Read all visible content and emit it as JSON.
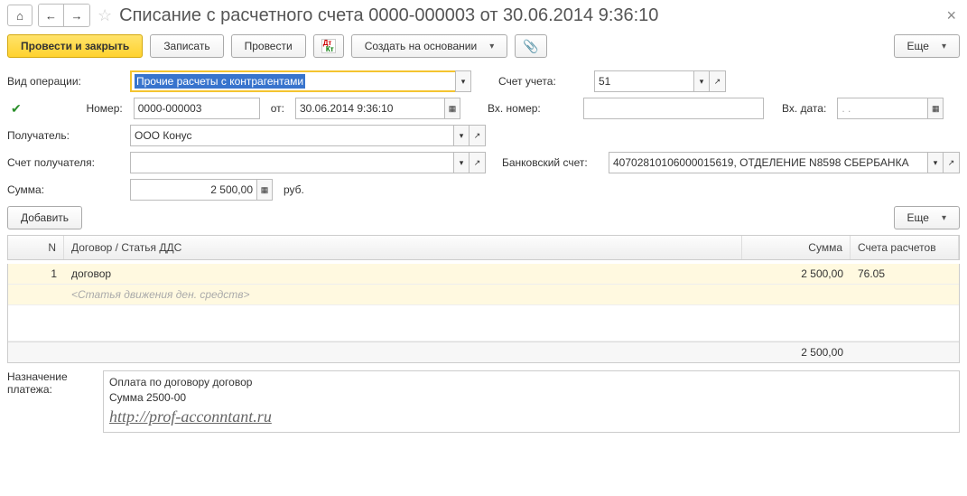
{
  "header": {
    "title": "Списание с расчетного счета 0000-000003 от 30.06.2014 9:36:10"
  },
  "toolbar": {
    "post_and_close": "Провести и закрыть",
    "save": "Записать",
    "post": "Провести",
    "create_based_on": "Создать на основании",
    "more": "Еще"
  },
  "form": {
    "operation_type_label": "Вид операции:",
    "operation_type_value": "Прочие расчеты с контрагентами",
    "account_label": "Счет учета:",
    "account_value": "51",
    "number_label": "Номер:",
    "number_value": "0000-000003",
    "from_label": "от:",
    "date_value": "30.06.2014  9:36:10",
    "ext_number_label": "Вх. номер:",
    "ext_number_value": "",
    "ext_date_label": "Вх. дата:",
    "ext_date_value": "  .  .",
    "recipient_label": "Получатель:",
    "recipient_value": "ООО Конус",
    "recipient_account_label": "Счет получателя:",
    "recipient_account_value": "",
    "bank_account_label": "Банковский счет:",
    "bank_account_value": "40702810106000015619, ОТДЕЛЕНИЕ N8598 СБЕРБАНКА",
    "amount_label": "Сумма:",
    "amount_value": "2 500,00",
    "currency": "руб."
  },
  "table_toolbar": {
    "add": "Добавить",
    "more": "Еще"
  },
  "table": {
    "headers": {
      "n": "N",
      "contract": "Договор / Статья ДДС",
      "sum": "Сумма",
      "accounts": "Счета расчетов"
    },
    "rows": [
      {
        "n": "1",
        "contract": "договор",
        "dds_placeholder": "<Статья движения ден. средств>",
        "sum": "2 500,00",
        "account": "76.05"
      }
    ],
    "footer_sum": "2 500,00"
  },
  "memo": {
    "label_line1": "Назначение",
    "label_line2": "платежа:",
    "line1": "Оплата по договору договор",
    "line2": "Сумма 2500-00",
    "watermark": "http://prof-acconntant.ru"
  }
}
